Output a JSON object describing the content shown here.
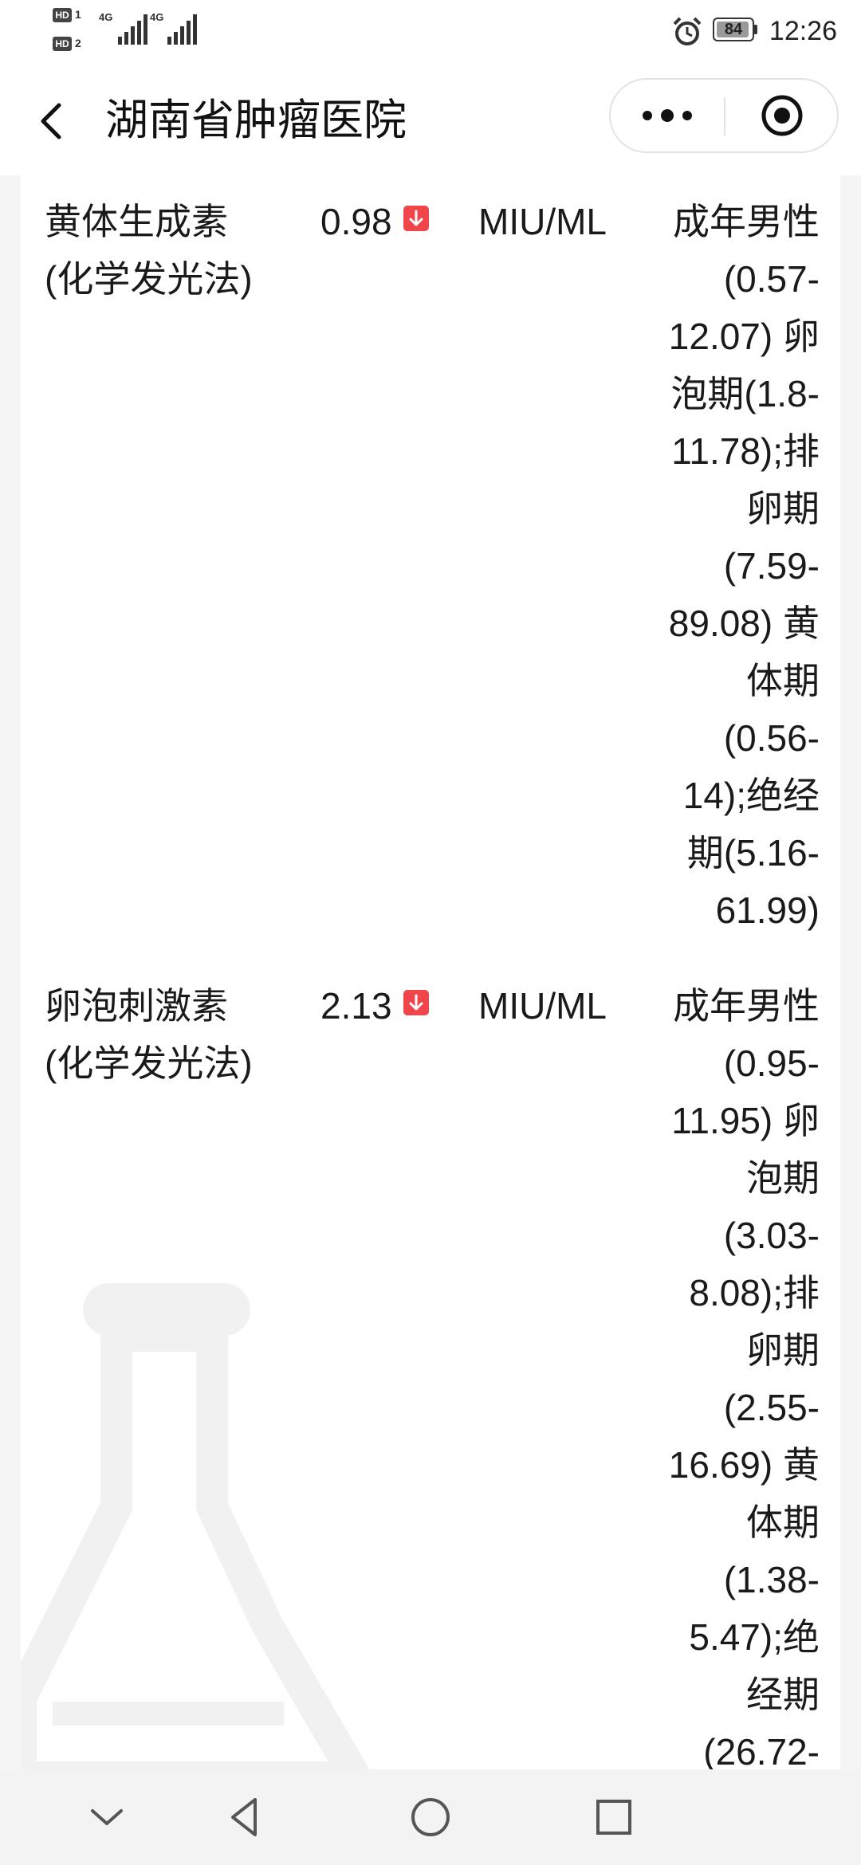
{
  "status_bar": {
    "sim1_label": "HD",
    "sim1_num": "1",
    "sim2_label": "HD",
    "sim2_num": "2",
    "network1": "4G",
    "network2": "4G",
    "battery_level": "84",
    "time": "12:26",
    "icons": [
      "alarm-icon",
      "battery-icon",
      "signal-icon"
    ]
  },
  "nav": {
    "title": "湖南省肿瘤医院",
    "back_icon": "chevron-left-icon",
    "more_icon": "more-dots-icon",
    "close_icon": "target-circle-icon"
  },
  "results": [
    {
      "name_line1": "黄体生成素",
      "name_line2": "(化学发光法)",
      "value": "0.98",
      "flag": "down",
      "unit": "MIU/ML",
      "range_lines": [
        "成年男性",
        "(0.57-",
        "12.07) 卵",
        "泡期(1.8-",
        "11.78);排",
        "卵期",
        "(7.59-",
        "89.08) 黄",
        "体期",
        "(0.56-",
        "14);绝经",
        "期(5.16-",
        "61.99)"
      ]
    },
    {
      "name_line1": "卵泡刺激素",
      "name_line2": "(化学发光法)",
      "value": "2.13",
      "flag": "down",
      "unit": "MIU/ML",
      "range_lines": [
        "成年男性",
        "(0.95-",
        "11.95) 卵",
        "泡期",
        "(3.03-",
        "8.08);排",
        "卵期",
        "(2.55-",
        "16.69) 黄",
        "体期",
        "(1.38-",
        "5.47);绝",
        "经期",
        "(26.72-"
      ]
    }
  ],
  "colors": {
    "flag_down": "#f0454a",
    "background": "#f5f5f5",
    "card": "#ffffff"
  },
  "system_nav": {
    "icons": [
      "chevron-down-icon",
      "back-triangle-icon",
      "home-circle-icon",
      "recents-square-icon"
    ]
  }
}
